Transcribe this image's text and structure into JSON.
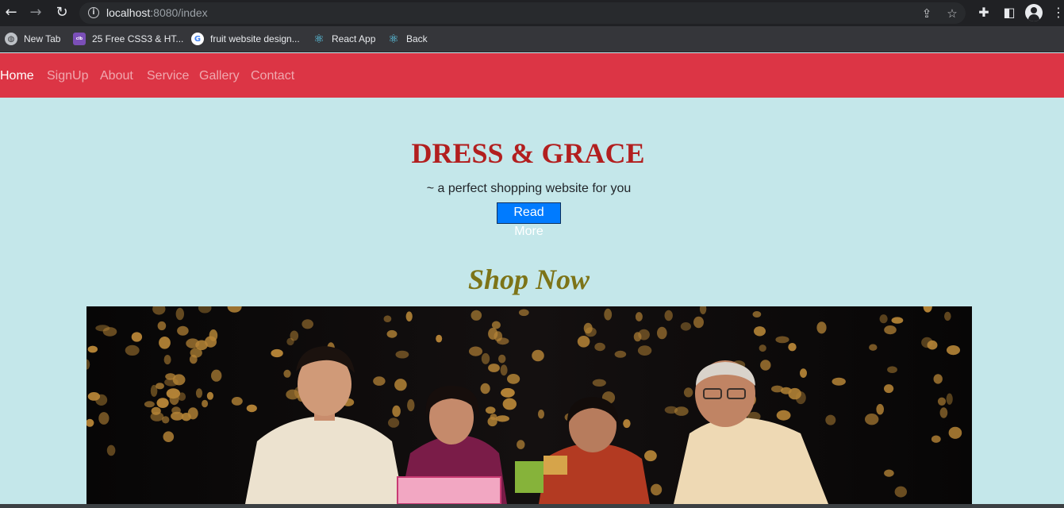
{
  "browser": {
    "url_host": "localhost",
    "url_rest": ":8080/index",
    "bookmarks": [
      {
        "label": "New Tab",
        "icon": "globe-icon"
      },
      {
        "label": "25 Free CSS3 & HT...",
        "icon": "colorlib-icon"
      },
      {
        "label": "fruit website design...",
        "icon": "google-icon"
      },
      {
        "label": "React App",
        "icon": "react-icon"
      },
      {
        "label": "Back",
        "icon": "react-icon"
      }
    ]
  },
  "nav": {
    "items": [
      "Home",
      "SignUp",
      "About",
      "Service",
      "Gallery",
      "Contact"
    ],
    "active": "Home"
  },
  "hero": {
    "title": "DRESS & GRACE",
    "subtitle": "~ a perfect shopping website for you",
    "button": "Read More"
  },
  "shop": {
    "title": "Shop Now"
  },
  "colors": {
    "page_bg": "#c4e7ea",
    "navbar": "#dc3545",
    "title": "#b21f1f",
    "shop_title": "#7d7418",
    "button": "#007bff"
  }
}
